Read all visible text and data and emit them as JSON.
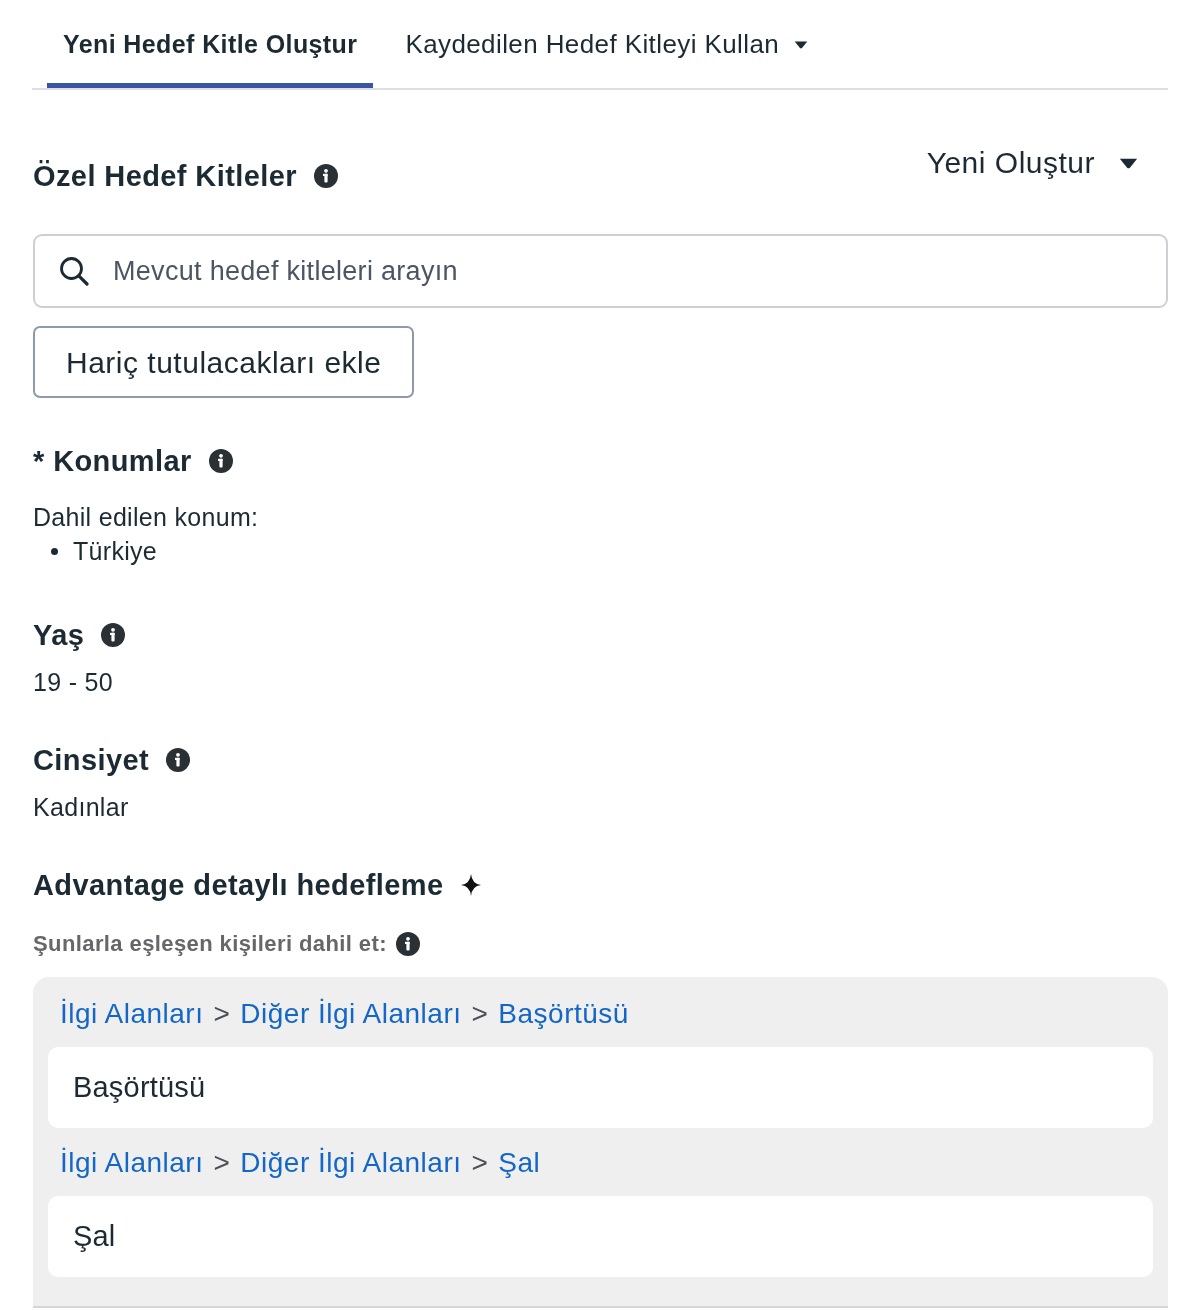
{
  "tabs": [
    {
      "label": "Yeni Hedef Kitle Oluştur",
      "selected": true,
      "dropdown": false
    },
    {
      "label": "Kaydedilen Hedef Kitleyi Kullan",
      "selected": false,
      "dropdown": true
    }
  ],
  "custom_audiences": {
    "title": "Özel Hedef Kitleler",
    "create_menu": "Yeni Oluştur",
    "search": {
      "placeholder": "Mevcut hedef kitleleri arayın"
    },
    "exclude_button": "Hariç tutulacakları ekle"
  },
  "locations": {
    "title": "* Konumlar",
    "included_label": "Dahil edilen konum:",
    "items": [
      "Türkiye"
    ]
  },
  "age": {
    "title": "Yaş",
    "value": "19 - 50"
  },
  "gender": {
    "title": "Cinsiyet",
    "value": "Kadınlar"
  },
  "detailed_targeting": {
    "title": "Advantage detaylı hedefleme",
    "include_label": "Şunlarla eşleşen kişileri dahil et:",
    "interests": [
      {
        "breadcrumb": [
          "İlgi Alanları",
          ">",
          "Diğer İlgi Alanları",
          ">",
          "Başörtüsü"
        ],
        "name": "Başörtüsü"
      },
      {
        "breadcrumb": [
          "İlgi Alanları",
          ">",
          "Diğer İlgi Alanları",
          ">",
          "Şal"
        ],
        "name": "Şal"
      }
    ]
  }
}
